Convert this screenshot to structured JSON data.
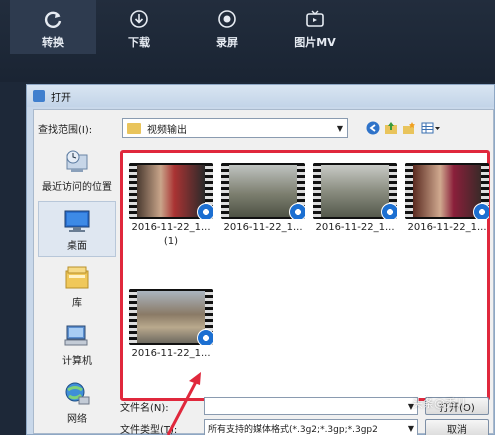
{
  "app": {
    "tabs": [
      {
        "label": "转换",
        "icon": "refresh-icon",
        "active": true
      },
      {
        "label": "下载",
        "icon": "download-icon",
        "active": false
      },
      {
        "label": "录屏",
        "icon": "record-icon",
        "active": false
      },
      {
        "label": "图片MV",
        "icon": "tv-icon",
        "active": false
      }
    ]
  },
  "dialog": {
    "title": "打开",
    "look_in_label": "查找范围(I):",
    "look_in_value": "视频输出",
    "places": [
      {
        "label": "最近访问的位置",
        "icon": "recent-places-icon"
      },
      {
        "label": "桌面",
        "icon": "desktop-icon"
      },
      {
        "label": "库",
        "icon": "libraries-icon"
      },
      {
        "label": "计算机",
        "icon": "computer-icon"
      },
      {
        "label": "网络",
        "icon": "network-icon"
      }
    ],
    "files": [
      {
        "name_line1": "2016-11-22_1...",
        "name_line2": "(1)"
      },
      {
        "name_line1": "2016-11-22_1...",
        "name_line2": ""
      },
      {
        "name_line1": "2016-11-22_1...",
        "name_line2": ""
      },
      {
        "name_line1": "2016-11-22_1...",
        "name_line2": ""
      },
      {
        "name_line1": "2016-11-22_1...",
        "name_line2": ""
      }
    ],
    "filename_label": "文件名(N):",
    "filename_value": "",
    "filetype_label": "文件类型(T):",
    "filetype_value": "所有支持的媒体格式(*.3g2;*.3gp;*.3gp2",
    "open_button": "打开(O)",
    "cancel_button": "取消"
  },
  "watermark": "头条@秀儿",
  "colors": {
    "highlight_border": "#e0283c",
    "topbar_bg": "#1d2838",
    "dialog_frame": "#c9d8ea"
  }
}
